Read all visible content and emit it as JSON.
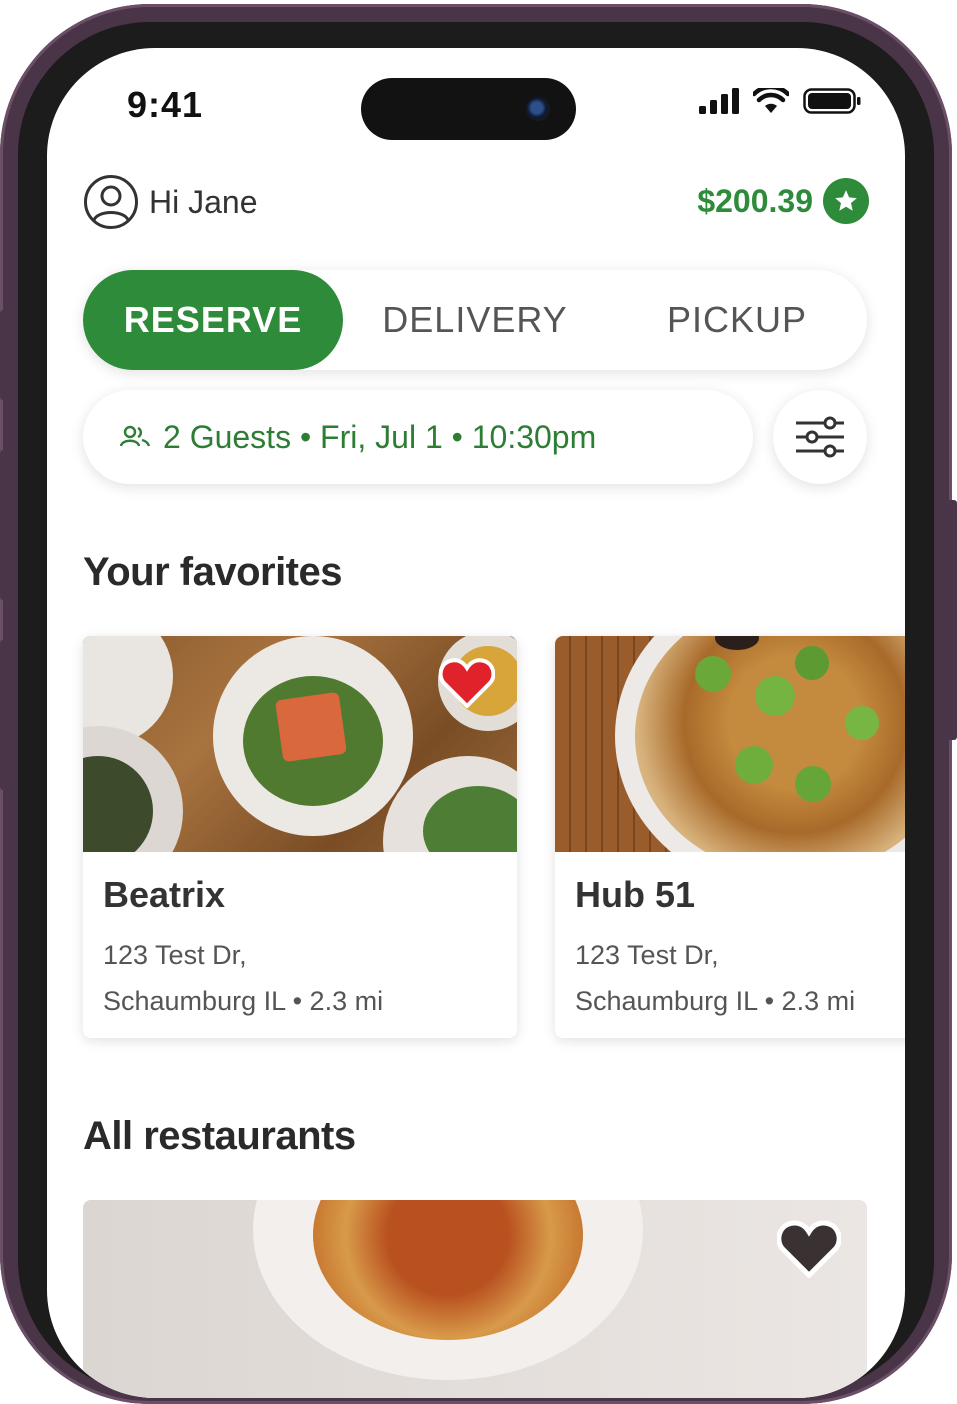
{
  "status": {
    "time": "9:41"
  },
  "header": {
    "greeting": "Hi Jane",
    "balance": "$200.39"
  },
  "tabs": [
    "RESERVE",
    "DELIVERY",
    "PICKUP"
  ],
  "search": {
    "summary": "2 Guests • Fri, Jul 1 • 10:30pm"
  },
  "favorites": {
    "title": "Your favorites",
    "cards": [
      {
        "name": "Beatrix",
        "address_line1": "123 Test Dr,",
        "address_line2": "Schaumburg IL • 2.3 mi"
      },
      {
        "name": "Hub 51",
        "address_line1": "123 Test Dr,",
        "address_line2": "Schaumburg IL • 2.3 mi"
      }
    ]
  },
  "all": {
    "title": "All restaurants"
  },
  "colors": {
    "accent": "#2e8b3a",
    "heart_fav": "#e0222a"
  }
}
